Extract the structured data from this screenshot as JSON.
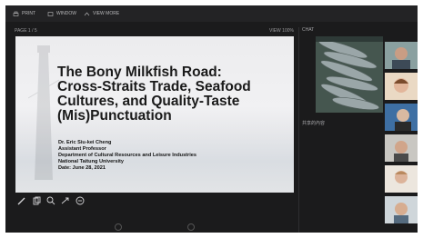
{
  "toolbar": {
    "items": [
      {
        "label": "PRINT",
        "icon": "print-icon"
      },
      {
        "label": "WINDOW",
        "icon": "window-icon"
      },
      {
        "label": "VIEW MORE",
        "icon": "more-icon"
      }
    ]
  },
  "viewer": {
    "page_indicator": "PAGE 1 / 5",
    "zoom": "VIEW 100%"
  },
  "slide": {
    "title_lines": [
      "The Bony Milkfish Road:",
      "Cross-Straits Trade, Seafood",
      "Cultures, and Quality-Taste",
      "(Mis)Punctuation"
    ],
    "author": "Dr. Eric Siu-kei Cheng",
    "position": "Assistant Professor",
    "department": "Department of Cultural Resources and Leisure Industries",
    "university": "National Taitung University",
    "date": "Date: June 28, 2021"
  },
  "side_panel": {
    "label": "CHAT",
    "caption": "共享的內容"
  },
  "participants": [
    {
      "name": "participant-1"
    },
    {
      "name": "participant-2"
    },
    {
      "name": "participant-3"
    },
    {
      "name": "participant-4"
    },
    {
      "name": "participant-5"
    },
    {
      "name": "participant-6"
    }
  ],
  "colors": {
    "app_bg": "#1b1b1c",
    "slide_text": "#1a1a1a"
  }
}
